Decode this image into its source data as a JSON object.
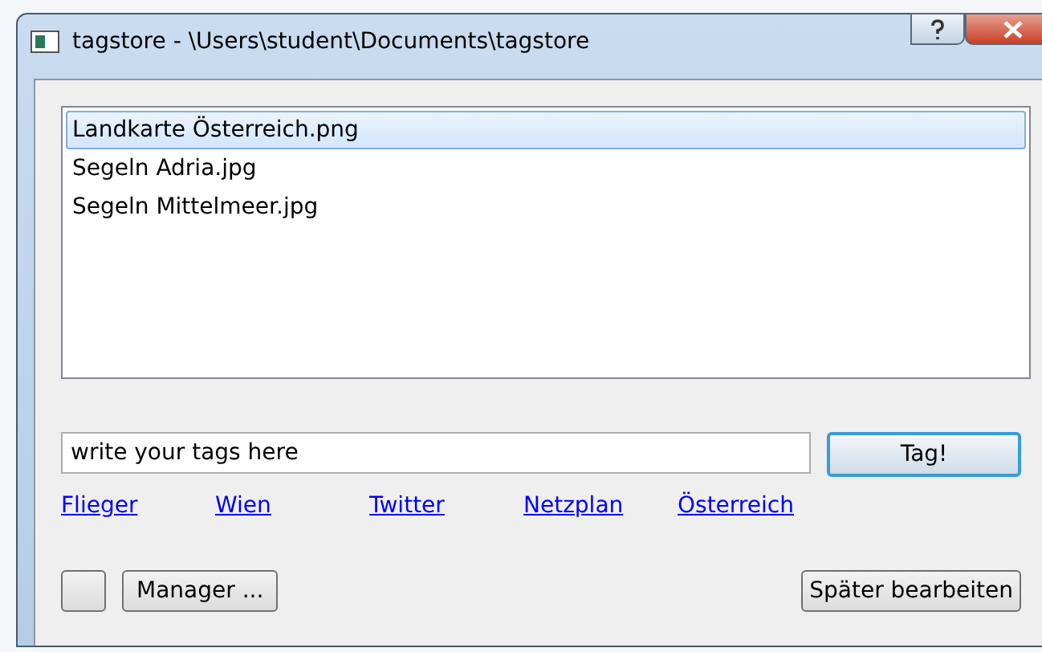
{
  "window": {
    "title": "tagstore - \\Users\\student\\Documents\\tagstore"
  },
  "files": [
    {
      "name": "Landkarte Österreich.png",
      "selected": true
    },
    {
      "name": "Segeln Adria.jpg",
      "selected": false
    },
    {
      "name": "Segeln Mittelmeer.jpg",
      "selected": false
    }
  ],
  "tag_input": {
    "value": "write your tags here"
  },
  "tag_button": "Tag!",
  "tag_links": [
    "Flieger",
    "Wien",
    "Twitter",
    "Netzplan",
    "Österreich"
  ],
  "buttons": {
    "manager": "Manager ...",
    "later": "Später bearbeiten"
  }
}
